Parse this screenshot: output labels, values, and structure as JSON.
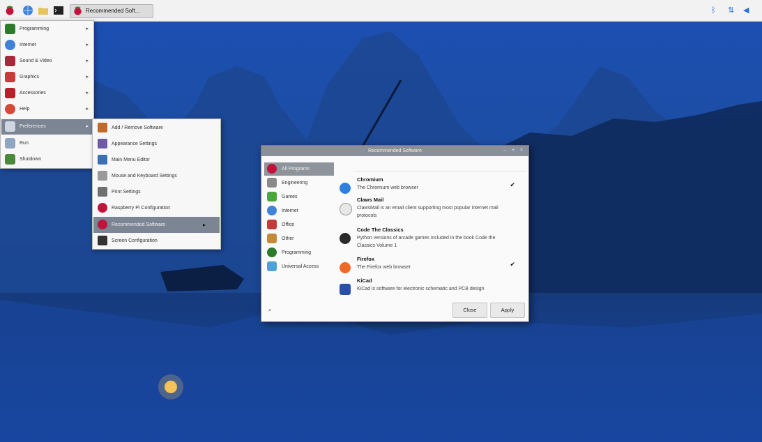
{
  "taskbar": {
    "window_button_label": "Recommended Soft...",
    "launcher_icons": [
      "raspberry-icon",
      "browser-icon",
      "folder-icon",
      "terminal-icon"
    ],
    "tray_icons": [
      "bluetooth-icon",
      "network-icon",
      "volume-icon"
    ]
  },
  "main_menu": {
    "items": [
      {
        "label": "Programming",
        "icon": "programming-icon",
        "has_submenu": true
      },
      {
        "label": "Internet",
        "icon": "internet-icon",
        "has_submenu": true
      },
      {
        "label": "Sound & Video",
        "icon": "sound-video-icon",
        "has_submenu": true
      },
      {
        "label": "Graphics",
        "icon": "graphics-icon",
        "has_submenu": true
      },
      {
        "label": "Accessories",
        "icon": "accessories-icon",
        "has_submenu": true
      },
      {
        "label": "Help",
        "icon": "help-icon",
        "has_submenu": true
      },
      {
        "label": "Preferences",
        "icon": "preferences-icon",
        "has_submenu": true,
        "selected": true
      },
      {
        "label": "Run",
        "icon": "run-icon",
        "has_submenu": false
      },
      {
        "label": "Shutdown",
        "icon": "shutdown-icon",
        "has_submenu": false
      }
    ]
  },
  "sub_menu": {
    "items": [
      {
        "label": "Add / Remove Software",
        "icon": "package-icon"
      },
      {
        "label": "Appearance Settings",
        "icon": "appearance-icon"
      },
      {
        "label": "Main Menu Editor",
        "icon": "menu-editor-icon"
      },
      {
        "label": "Mouse and Keyboard Settings",
        "icon": "keyboard-icon"
      },
      {
        "label": "Print Settings",
        "icon": "printer-icon"
      },
      {
        "label": "Raspberry Pi Configuration",
        "icon": "raspberry-icon"
      },
      {
        "label": "Recommended Software",
        "icon": "raspberry-icon",
        "selected": true
      },
      {
        "label": "Screen Configuration",
        "icon": "monitor-icon"
      }
    ]
  },
  "dialog": {
    "title": "Recommended Software",
    "categories": [
      {
        "label": "All Programs",
        "icon": "raspberry-icon",
        "selected": true
      },
      {
        "label": "Engineering",
        "icon": "compass-icon"
      },
      {
        "label": "Games",
        "icon": "games-icon"
      },
      {
        "label": "Internet",
        "icon": "globe-icon"
      },
      {
        "label": "Office",
        "icon": "office-icon"
      },
      {
        "label": "Other",
        "icon": "other-icon"
      },
      {
        "label": "Programming",
        "icon": "programming-icon"
      },
      {
        "label": "Universal Access",
        "icon": "accessibility-icon"
      }
    ],
    "programs": [
      {
        "name": "Chromium",
        "description": "The Chromium web browser",
        "icon": "chromium-icon",
        "installed": true
      },
      {
        "name": "Claws Mail",
        "description": "ClawsMail is an email client supporting most popular internet mail protocols",
        "icon": "mail-icon",
        "installed": false
      },
      {
        "name": "Code The Classics",
        "description": "Python versions of arcade games included in the book Code the Classics Volume 1",
        "icon": "arcade-icon",
        "installed": false
      },
      {
        "name": "Firefox",
        "description": "The Firefox web browser",
        "icon": "firefox-icon",
        "installed": true
      },
      {
        "name": "KiCad",
        "description": "KiCad is software for electronic schematic and PCB design",
        "icon": "kicad-icon",
        "installed": false
      }
    ],
    "close_label": "Close",
    "apply_label": "Apply"
  },
  "colors": {
    "sky": "#1d4fa8",
    "mountain": "#1a3f85",
    "water": "#153e88",
    "panel": "#f2f2f2",
    "menu_selection": "#7b8594"
  }
}
